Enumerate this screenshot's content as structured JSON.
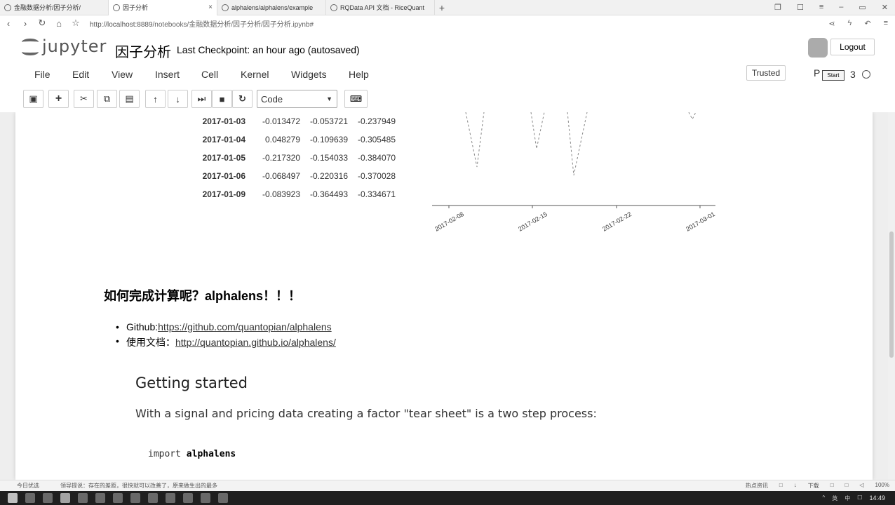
{
  "browser": {
    "tabs": [
      {
        "label": "金融数据分析/因子分析/",
        "icon": "refresh-icon",
        "active": false
      },
      {
        "label": "因子分析",
        "icon": "refresh-icon",
        "active": true
      },
      {
        "label": "alphalens/alphalens/example",
        "icon": "github-icon",
        "active": false
      },
      {
        "label": "RQData API 文档 - RiceQuant",
        "icon": "ricequant-icon",
        "active": false
      }
    ],
    "close_glyph": "×",
    "new_tab_glyph": "+",
    "url_host": "http://localhost:8889",
    "url_path": "/notebooks/金融数据分析/因子分析/因子分析.ipynb#"
  },
  "jupyter": {
    "logo_text": "jupyter",
    "notebook_title": "因子分析",
    "checkpoint": "Last Checkpoint: an hour ago (autosaved)",
    "logout_label": "Logout",
    "menu": [
      "File",
      "Edit",
      "View",
      "Insert",
      "Cell",
      "Kernel",
      "Widgets",
      "Help"
    ],
    "trusted_label": "Trusted",
    "kernel_label": "P",
    "start_tooltip": "Start",
    "kernel_suffix": "3",
    "cell_type": "Code"
  },
  "dataframe": {
    "rows": [
      {
        "index": "2017-01-03",
        "values": [
          "-0.013472",
          "-0.053721",
          "-0.237949"
        ]
      },
      {
        "index": "2017-01-04",
        "values": [
          "0.048279",
          "-0.109639",
          "-0.305485"
        ]
      },
      {
        "index": "2017-01-05",
        "values": [
          "-0.217320",
          "-0.154033",
          "-0.384070"
        ]
      },
      {
        "index": "2017-01-06",
        "values": [
          "-0.068497",
          "-0.220316",
          "-0.370028"
        ]
      },
      {
        "index": "2017-01-09",
        "values": [
          "-0.083923",
          "-0.364493",
          "-0.334671"
        ]
      }
    ]
  },
  "chart_data": {
    "type": "line",
    "x_tick_labels": [
      "2017-02-08",
      "2017-02-15",
      "2017-02-22",
      "2017-03-01"
    ],
    "grid": false,
    "legend": false
  },
  "markdown": {
    "heading": "如何完成计算呢？alphalens！！！",
    "links": [
      {
        "prefix": "Github:",
        "text": "https://github.com/quantopian/alphalens"
      },
      {
        "prefix": "使用文档：",
        "text": "http://quantopian.github.io/alphalens/"
      }
    ],
    "gs_heading": "Getting started",
    "gs_text": "With a signal and pricing data creating a factor \"tear sheet\" is a two step process:",
    "code_kw": "import",
    "code_mod": "alphalens"
  },
  "status": {
    "left1": "今日优选",
    "left2": "领导提说：存在的差距，很快就可以改善了，原来做生出的最多",
    "right_items": [
      "热点资讯",
      "□",
      "↓",
      "下载",
      "□",
      "□",
      "◁",
      "100%"
    ]
  },
  "taskbar": {
    "clock": "14:49",
    "tray": [
      "^",
      "英",
      "中",
      "☐"
    ]
  }
}
